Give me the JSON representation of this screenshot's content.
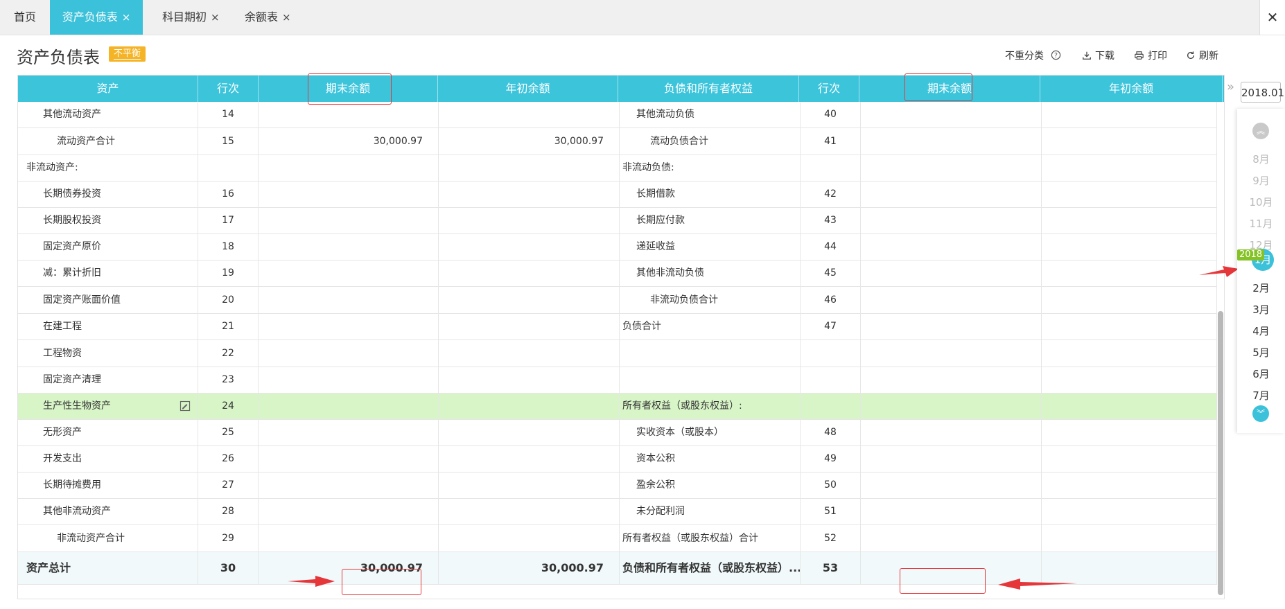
{
  "tabs": [
    {
      "label": "首页",
      "close": ""
    },
    {
      "label": "资产负债表",
      "close": "×"
    },
    {
      "label": "科目期初",
      "close": "×"
    },
    {
      "label": "余额表",
      "close": "×"
    }
  ],
  "window_close": "✕",
  "page_title": "资产负债表",
  "status_badge": "不平衡",
  "toolbar": {
    "no_reclass": "不重分类",
    "download": "下载",
    "print": "打印",
    "refresh": "刷新"
  },
  "table": {
    "headers": [
      "资产",
      "行次",
      "期末余额",
      "年初余额",
      "负债和所有者权益",
      "行次",
      "期末余额",
      "年初余额"
    ],
    "rows": [
      [
        "其他流动资产",
        "14",
        "",
        "",
        "其他流动负债",
        "40",
        "",
        ""
      ],
      [
        "流动资产合计",
        "15",
        "30,000.97",
        "30,000.97",
        "流动负债合计",
        "41",
        "",
        ""
      ],
      [
        "非流动资产:",
        "",
        "",
        "",
        "非流动负债:",
        "",
        "",
        ""
      ],
      [
        "长期债券投资",
        "16",
        "",
        "",
        "长期借款",
        "42",
        "",
        ""
      ],
      [
        "长期股权投资",
        "17",
        "",
        "",
        "长期应付款",
        "43",
        "",
        ""
      ],
      [
        "固定资产原价",
        "18",
        "",
        "",
        "递延收益",
        "44",
        "",
        ""
      ],
      [
        "减：累计折旧",
        "19",
        "",
        "",
        "其他非流动负债",
        "45",
        "",
        ""
      ],
      [
        "固定资产账面价值",
        "20",
        "",
        "",
        "非流动负债合计",
        "46",
        "",
        ""
      ],
      [
        "在建工程",
        "21",
        "",
        "",
        "负债合计",
        "47",
        "",
        ""
      ],
      [
        "工程物资",
        "22",
        "",
        "",
        "",
        "",
        "",
        ""
      ],
      [
        "固定资产清理",
        "23",
        "",
        "",
        "",
        "",
        "",
        ""
      ],
      [
        "生产性生物资产",
        "24",
        "",
        "",
        "所有者权益（或股东权益）:",
        "",
        "",
        ""
      ],
      [
        "无形资产",
        "25",
        "",
        "",
        "实收资本（或股本）",
        "48",
        "",
        ""
      ],
      [
        "开发支出",
        "26",
        "",
        "",
        "资本公积",
        "49",
        "",
        ""
      ],
      [
        "长期待摊费用",
        "27",
        "",
        "",
        "盈余公积",
        "50",
        "",
        ""
      ],
      [
        "其他非流动资产",
        "28",
        "",
        "",
        "未分配利润",
        "51",
        "",
        ""
      ],
      [
        "非流动资产合计",
        "29",
        "",
        "",
        "所有者权益（或股东权益）合计",
        "52",
        "",
        ""
      ],
      [
        "资产总计",
        "30",
        "30,000.97",
        "30,000.97",
        "负债和所有者权益（或股东权益）...",
        "53",
        "",
        ""
      ]
    ]
  },
  "date_picker": {
    "value": "2018.01",
    "year_tag": "2018",
    "months": [
      "8月",
      "9月",
      "10月",
      "11月",
      "12月",
      "1月",
      "2月",
      "3月",
      "4月",
      "5月",
      "6月",
      "7月"
    ],
    "active_month": "1月"
  },
  "colors": {
    "accent": "#3bc1d9",
    "badge": "#f5b326",
    "highlight_row": "#d8f5c8",
    "annotation_red": "#e5363a",
    "year_tag": "#84c225"
  }
}
